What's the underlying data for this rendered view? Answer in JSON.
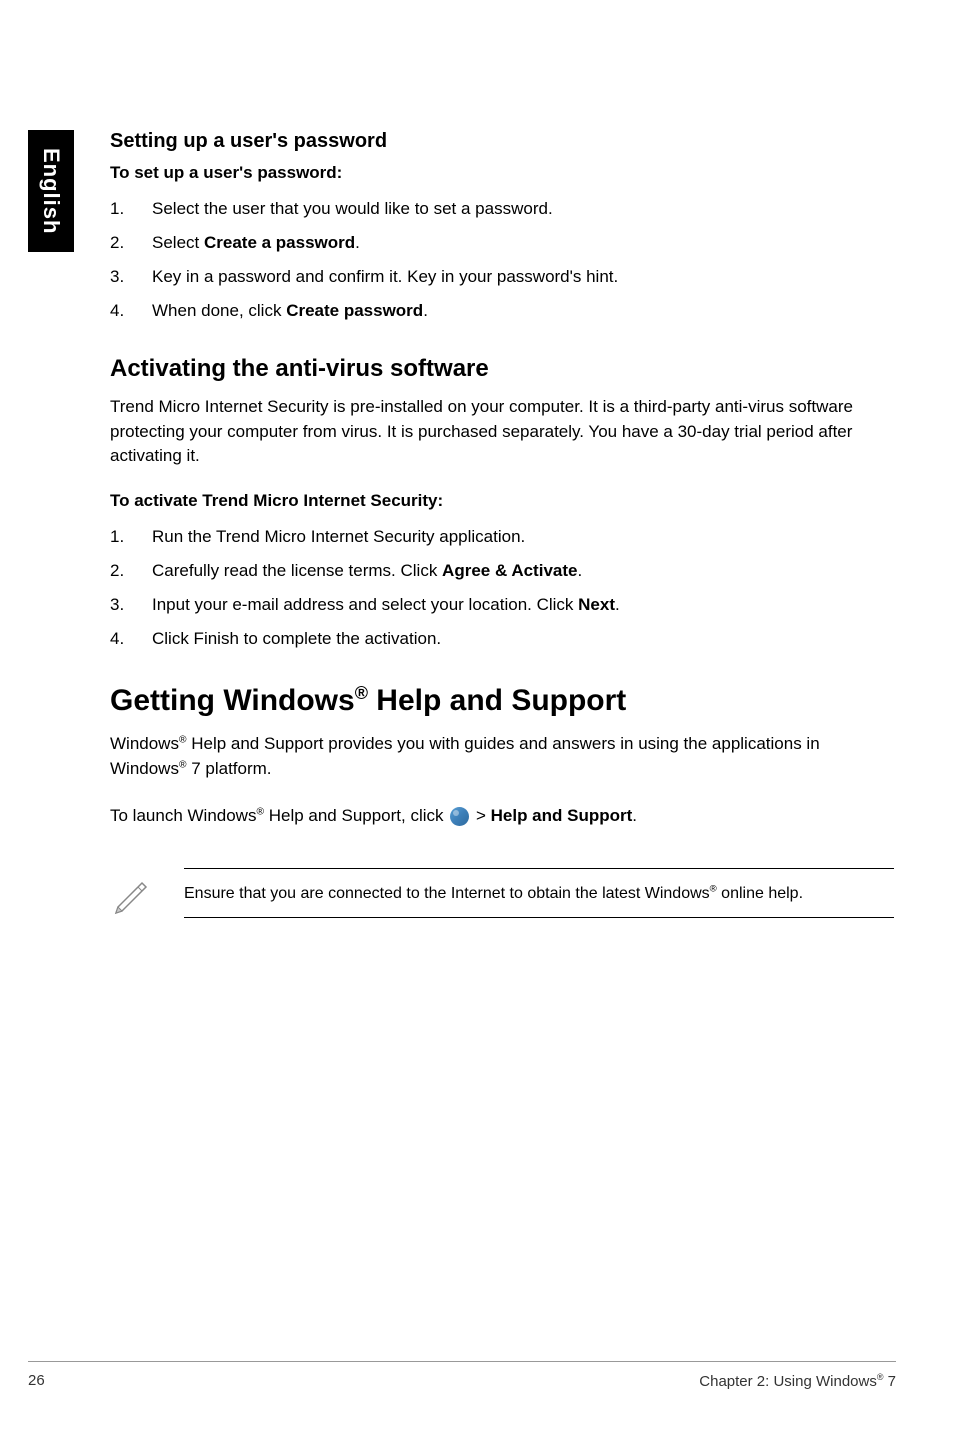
{
  "sidebar": {
    "language": "English"
  },
  "section1": {
    "heading": "Setting up a user's password",
    "intro": "To set up a user's password:",
    "step1": "Select the user that you would like to set a password.",
    "step2_pre": "Select ",
    "step2_bold": "Create a password",
    "step2_post": ".",
    "step3": "Key in a password and confirm it. Key in your password's hint.",
    "step4_pre": "When done, click ",
    "step4_bold": "Create password",
    "step4_post": "."
  },
  "section2": {
    "heading": "Activating the anti-virus software",
    "body": "Trend Micro Internet Security is pre-installed on your computer. It is a third-party anti-virus software protecting your computer from virus. It is purchased separately. You have a 30-day trial period after activating it.",
    "intro": "To activate Trend Micro Internet Security:",
    "step1": "Run the Trend Micro Internet Security application.",
    "step2_pre": "Carefully read the license terms. Click ",
    "step2_bold": "Agree & Activate",
    "step2_post": ".",
    "step3_pre": "Input your e-mail address and select your location. Click ",
    "step3_bold": "Next",
    "step3_post": ".",
    "step4": "Click Finish to complete the activation."
  },
  "section3": {
    "heading_pre": "Getting Windows",
    "heading_sup": "®",
    "heading_post": " Help and Support",
    "body_pre": "Windows",
    "body_sup1": "®",
    "body_mid": " Help and Support provides you with guides and answers in using the applications in Windows",
    "body_sup2": "®",
    "body_post": " 7 platform.",
    "launch_pre": "To launch Windows",
    "launch_sup": "®",
    "launch_mid": " Help and Support, click ",
    "launch_gt": " > ",
    "launch_bold": "Help and Support",
    "launch_post": ".",
    "note_pre": "Ensure that you are connected to the Internet to obtain the latest Windows",
    "note_sup": "®",
    "note_post": " online help."
  },
  "footer": {
    "page_num": "26",
    "chapter_pre": "Chapter 2: Using Windows",
    "chapter_sup": "®",
    "chapter_post": " 7"
  }
}
